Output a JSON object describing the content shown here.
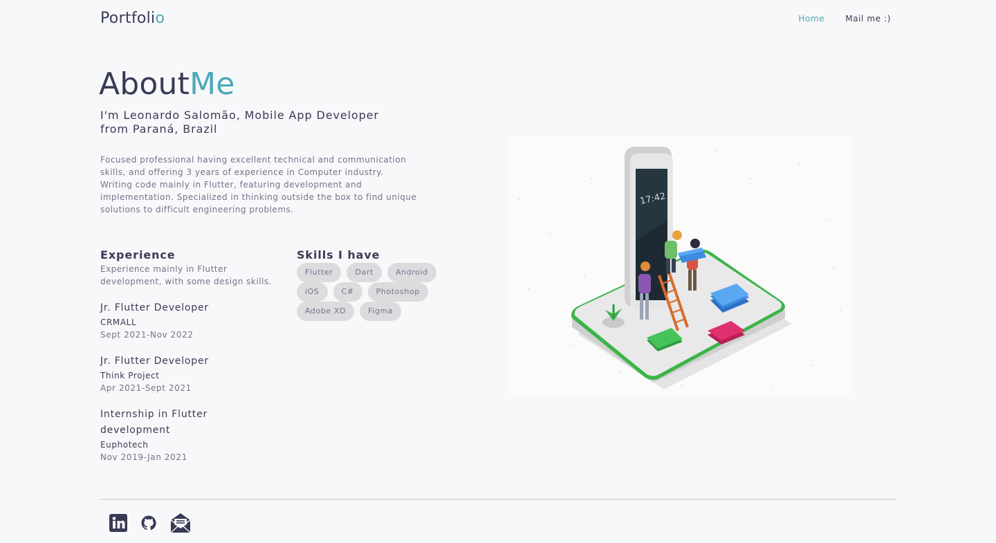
{
  "brand": {
    "logo_main": "Portfoli",
    "logo_accent": "o"
  },
  "nav": {
    "items": [
      {
        "label": "Home",
        "active": true
      },
      {
        "label": "Mail me :)",
        "active": false
      }
    ]
  },
  "hero": {
    "title_main": "About",
    "title_accent": "Me",
    "subtitle": "I'm Leonardo Salomão, Mobile App Developer from Paraná, Brazil",
    "description": "Focused professional having excellent technical and communication skills, and offering 3 years of experience in Computer industry. Writing code mainly in Flutter, featuring development and implementation. Specialized in thinking outside the box to find unique solutions to difficult engineering problems."
  },
  "experience": {
    "heading": "Experience",
    "description": "Experience mainly in Flutter development, with some design skills.",
    "jobs": [
      {
        "title": "Jr. Flutter Developer",
        "company": "CRMALL",
        "dates": "Sept 2021-Nov 2022"
      },
      {
        "title": "Jr. Flutter Developer",
        "company": "Think Project",
        "dates": "Apr 2021-Sept 2021"
      },
      {
        "title": "Internship in Flutter development",
        "company": "Euphotech",
        "dates": "Nov 2019-Jan 2021"
      }
    ]
  },
  "skills": {
    "heading": "Skills I have",
    "items": [
      "Flutter",
      "Dart",
      "Android",
      "iOS",
      "C#",
      "Photoshop",
      "Adobe XD",
      "Figma"
    ]
  },
  "illustration": {
    "phone_time": "17:42",
    "icon": "isometric-phone-team-illustration"
  },
  "footer": {
    "social": [
      {
        "icon": "linkedin-icon"
      },
      {
        "icon": "github-icon"
      },
      {
        "icon": "mail-open-icon"
      }
    ]
  },
  "colors": {
    "accent": "#4aa8b9",
    "text": "#3b3a55",
    "muted": "#75728a",
    "chip": "#dcdcdf",
    "background": "#f7f8fa"
  }
}
